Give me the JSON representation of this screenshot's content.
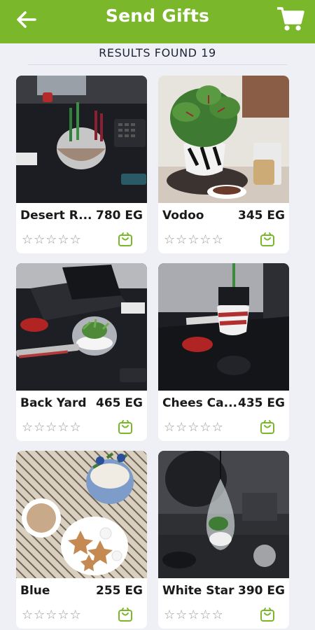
{
  "header": {
    "title": "Send Gifts",
    "back_icon": "arrow-left-icon",
    "cart_icon": "shopping-cart-icon",
    "bg_color": "#7ab72a"
  },
  "results_label": "RESULTS FOUND 19",
  "products": [
    {
      "name": "Desert R...",
      "price": "780 EG",
      "rating": 0,
      "photo": "desk terrarium with pens and calculator"
    },
    {
      "name": "Vodoo",
      "price": "345 EG",
      "rating": 0,
      "photo": "prayer plant in black-white pot"
    },
    {
      "name": "Back Yard",
      "price": "465 EG",
      "rating": 0,
      "photo": "glass globe terrarium on desk with laptop"
    },
    {
      "name": "Chees Ca...",
      "price": "435 EG",
      "rating": 0,
      "photo": "white-red vase with pen near mouse"
    },
    {
      "name": "Blue",
      "price": "255 EG",
      "rating": 0,
      "photo": "blue bowl with flowers, coffee and star cookies"
    },
    {
      "name": "White Star",
      "price": "390 EG",
      "rating": 0,
      "photo": "hanging glass teardrop terrarium"
    }
  ],
  "star_icon": "star-outline-icon",
  "basket_icon": "shopping-basket-icon",
  "accent_color": "#7ab72a"
}
